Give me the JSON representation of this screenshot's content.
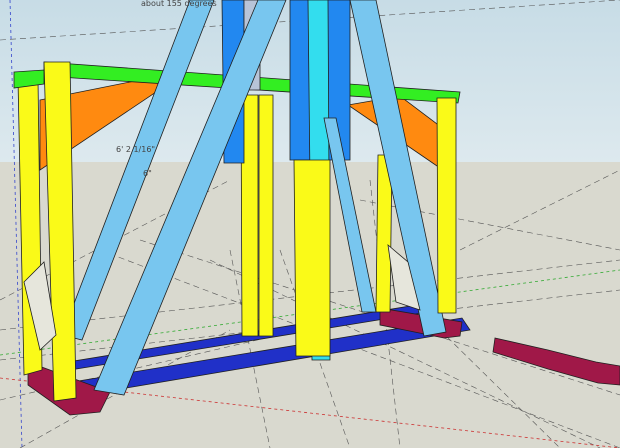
{
  "view": {
    "annotations": [
      {
        "id": "angle",
        "text": "about 155 degrees"
      },
      {
        "id": "dim-1",
        "text": "6' 2 1/16\""
      },
      {
        "id": "dim-2",
        "text": "6\""
      }
    ]
  },
  "colors": {
    "sky": "#b9d3dd",
    "ground": "#d9d9cf",
    "yellow": "#fafa18",
    "green": "#33ee22",
    "orange": "#ff8a10",
    "light_blue": "#78c6ef",
    "cyan": "#33ddee",
    "blue": "#2288f0",
    "dark_blue": "#2030c8",
    "maroon": "#a01848",
    "edge": "#202020"
  },
  "legend": {
    "yellow": "vertical-posts",
    "green": "top-rails",
    "orange": "corner-braces",
    "light_blue": "a-frame-legs",
    "blue": "center-mast",
    "cyan": "center-post",
    "dark_blue": "base-rails",
    "maroon": "base-feet"
  }
}
